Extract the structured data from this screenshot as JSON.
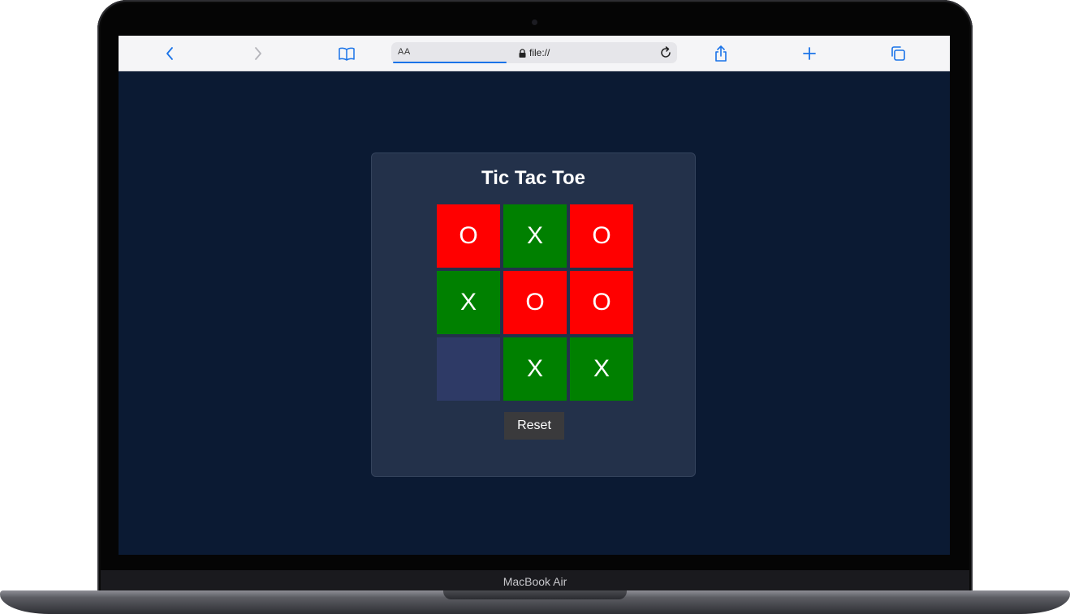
{
  "device": {
    "label": "MacBook Air"
  },
  "browser": {
    "reader_label": "AA",
    "url": "file://",
    "icons": [
      "back-icon",
      "forward-icon",
      "bookmarks-icon",
      "lock-icon",
      "reload-icon",
      "share-icon",
      "new-tab-icon",
      "tabs-icon"
    ],
    "accent_color": "#1a73e8"
  },
  "game": {
    "title": "Tic Tac Toe",
    "board": [
      [
        "O",
        "X",
        "O"
      ],
      [
        "X",
        "O",
        "O"
      ],
      [
        "",
        "X",
        "X"
      ]
    ],
    "reset_label": "Reset",
    "colors": {
      "page_background": "#0b1a33",
      "card_background": "#23314a",
      "o_cell": "#ff0000",
      "x_cell": "#008000",
      "empty_cell": "#2e3a66",
      "reset_button": "#3a3a3c"
    }
  }
}
